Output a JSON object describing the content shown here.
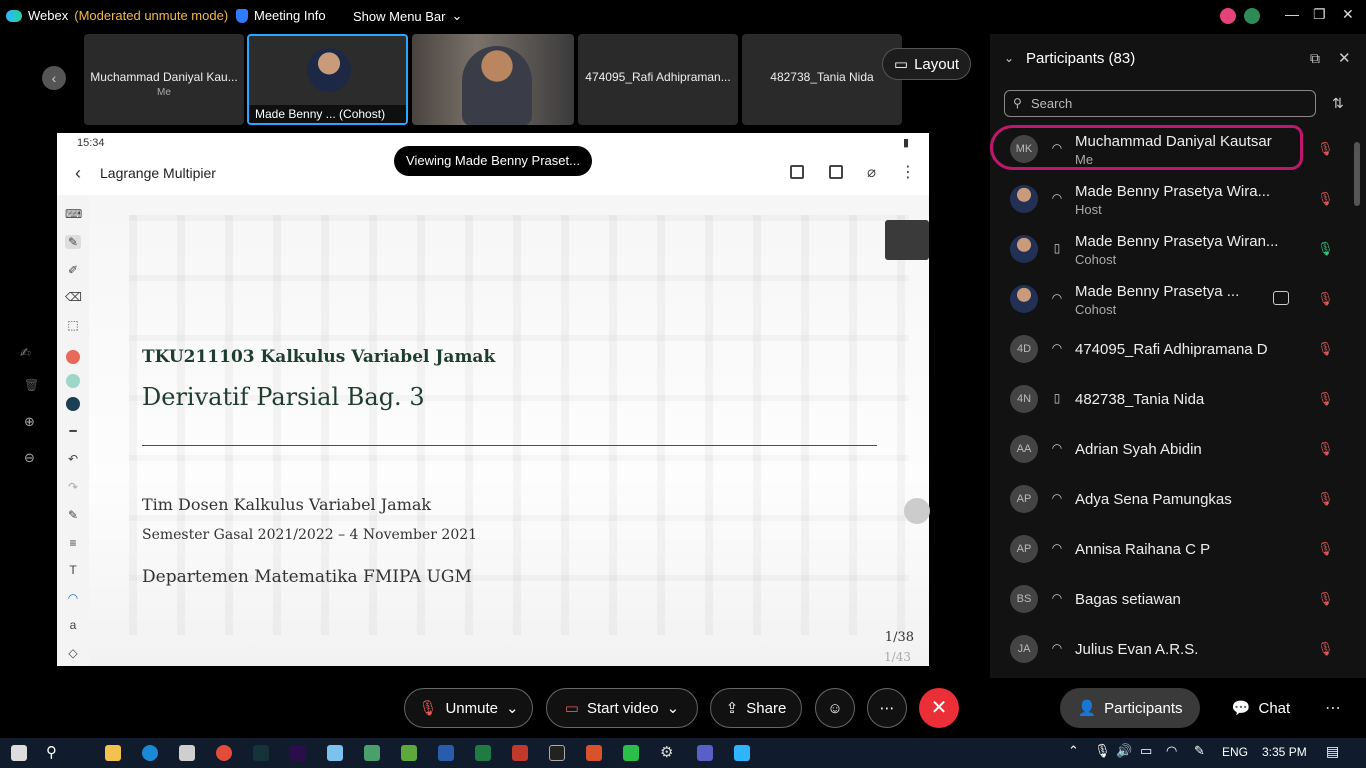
{
  "titlebar": {
    "app_name": "Webex",
    "moderation_status": "(Moderated unmute mode)",
    "meeting_info": "Meeting Info",
    "menu_bar": "Show Menu Bar"
  },
  "filmstrip": {
    "tiles": [
      {
        "name": "Muchammad Daniyal Kau...",
        "sub": "Me"
      },
      {
        "name": "Made Benny ...  (Cohost)"
      },
      {
        "name": ""
      },
      {
        "name": "474095_Rafi Adhipraman..."
      },
      {
        "name": "482738_Tania Nida"
      }
    ],
    "layout_label": "Layout"
  },
  "share": {
    "viewing_pill": "Viewing Made Benny Praset...",
    "status_time": "15:34",
    "doc_title": "Lagrange Multipier",
    "slide": {
      "course": "TKU211103 Kalkulus Variabel Jamak",
      "heading": "Derivatif Parsial Bag. 3",
      "team": "Tim Dosen Kalkulus Variabel Jamak",
      "semester": "Semester Gasal 2021/2022 – 4 November 2021",
      "dept": "Departemen Matematika FMIPA UGM",
      "page_a": "1/38",
      "page_b": "1/43"
    }
  },
  "participants": {
    "header": "Participants (83)",
    "search_placeholder": "Search",
    "rows": [
      {
        "initials": "MK",
        "name": "Muchammad Daniyal Kautsar",
        "role": "Me",
        "mic": "muted"
      },
      {
        "initials": "",
        "name": "Made Benny Prasetya Wira...",
        "role": "Host",
        "mic": "muted"
      },
      {
        "initials": "",
        "name": "Made Benny Prasetya Wiran...",
        "role": "Cohost",
        "mic": "on"
      },
      {
        "initials": "",
        "name": "Made Benny Prasetya ...",
        "role": "Cohost",
        "mic": "muted"
      },
      {
        "initials": "4D",
        "name": "474095_Rafi Adhipramana D",
        "role": "",
        "mic": "muted"
      },
      {
        "initials": "4N",
        "name": "482738_Tania Nida",
        "role": "",
        "mic": "muted"
      },
      {
        "initials": "AA",
        "name": "Adrian Syah Abidin",
        "role": "",
        "mic": "muted"
      },
      {
        "initials": "AP",
        "name": "Adya Sena Pamungkas",
        "role": "",
        "mic": "muted"
      },
      {
        "initials": "AP",
        "name": "Annisa Raihana C P",
        "role": "",
        "mic": "muted"
      },
      {
        "initials": "BS",
        "name": "Bagas setiawan",
        "role": "",
        "mic": "muted"
      },
      {
        "initials": "JA",
        "name": "Julius Evan A.R.S.",
        "role": "",
        "mic": "muted"
      }
    ]
  },
  "controls": {
    "unmute": "Unmute",
    "start_video": "Start video",
    "share": "Share",
    "participants": "Participants",
    "chat": "Chat"
  },
  "taskbar": {
    "language": "ENG",
    "time": "3:35 PM"
  },
  "colors": {
    "accent_blue": "#2aa7ff",
    "leave_red": "#ea2f36",
    "annotation_magenta": "#c0176e",
    "muted_red": "#e05a5a",
    "mic_on_green": "#3cc37a"
  }
}
